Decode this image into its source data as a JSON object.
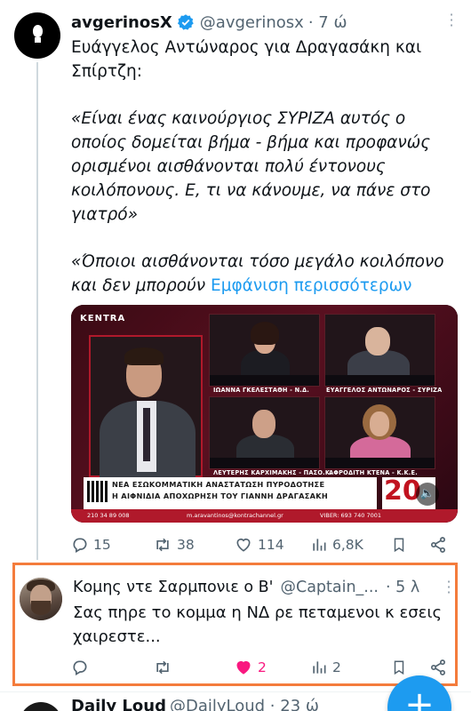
{
  "tweet": {
    "author_name": "avgerinosX",
    "handle": "@avgerinosx",
    "time": "· 7 ώ",
    "headline": "Ευάγγελος Αντώναρος για Δραγασάκη και Σπίρτζη:",
    "quote1": "«Είναι ένας καινούργιος ΣΥΡΙΖΑ αυτός ο οποίος δομείται βήμα - βήμα και προφανώς ορισμένοι αισθάνονται πολύ έντονους κοιλόπονους. Ε, τι να κάνουμε, να πάνε στο γιατρό»",
    "quote2": "«Όποιοι αισθάνονται τόσο μεγάλο κοιλόπονο και δεν μπορούν",
    "show_more": "Εμφάνιση περισσότερων",
    "media": {
      "channel_logo": "KENTRA",
      "captions": [
        "ΙΩΑΝΝΑ ΓΚΕΛΕΣΤΑΘΗ - Ν.Δ.",
        "ΕΥΑΓΓΕΛΟΣ ΑΝΤΩΝΑΡΟΣ - ΣΥΡΙΖΑ",
        "ΛΕΥΤΕΡΗΣ ΚΑΡΧΙΜΑΚΗΣ - ΠΑΣΟ.Κ.",
        "ΑΦΡΟΔΙΤΗ ΚΤΕΝΑ - Κ.Κ.Ε."
      ],
      "ticker_line1": "ΝΕΑ ΕΣΩΚΟΜΜΑΤΙΚΗ ΑΝΑΣΤΑΤΩΣΗ ΠΥΡΟΔΟΤΗΣΕ",
      "ticker_line2": "Η ΑΙΦΝΙΔΙΑ ΑΠΟΧΩΡΗΣΗ ΤΟΥ ΓΙΑΝΝΗ ΔΡΑΓΑΣΑΚΗ",
      "phone": "210 34 89 008",
      "email": "m.aravantinos@kontrachannel.gr",
      "viber": "VIBER: 693 740 7001",
      "badge": "20"
    },
    "stats": {
      "replies": "15",
      "retweets": "38",
      "likes": "114",
      "views": "6,8K"
    }
  },
  "reply": {
    "author_name": "Κομης ντε Σαρμπονιε ο Β'",
    "handle": "@Captain_...",
    "time": "· 5 λ",
    "text": "Σας πηρε το κομμα η ΝΔ ρε πεταμενοι κ εσεις χαιρεστε...",
    "stats": {
      "likes": "2",
      "views": "2"
    }
  },
  "next_tweet": {
    "author_name": "Daily Loud",
    "handle": "@DailyLoud · 23 ώ"
  },
  "colors": {
    "accent": "#1d9bf0",
    "like": "#f91880",
    "highlight": "#f47c3c",
    "muted": "#536471"
  }
}
